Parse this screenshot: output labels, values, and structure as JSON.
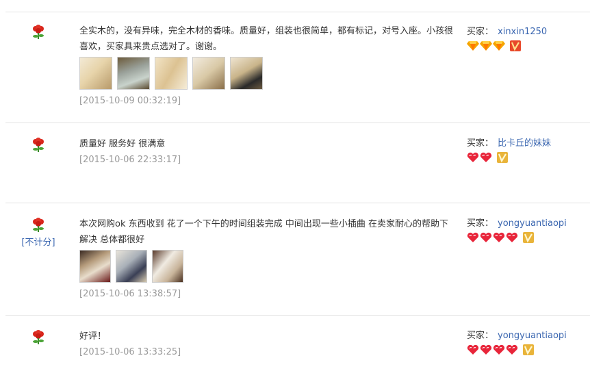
{
  "buyer_label": "买家：",
  "not_counted_label": "[不计分]",
  "reviews": [
    {
      "text": "全实木的，没有异味，完全木材的香味。质量好，组装也很简单，都有标记，对号入座。小孩很喜欢，买家具来贵点选对了。谢谢。",
      "date": "[2015-10-09 00:32:19]",
      "buyer": "xinxin1250",
      "badges": [
        "diamond",
        "diamond",
        "diamond"
      ],
      "vip": "red",
      "not_counted": false,
      "thumb_count": 5
    },
    {
      "text": "质量好 服务好 很满意",
      "date": "[2015-10-06 22:33:17]",
      "buyer": "比卡丘的妹妹",
      "badges": [
        "heart",
        "heart"
      ],
      "vip": "gold",
      "not_counted": false,
      "thumb_count": 0
    },
    {
      "text": "本次网购ok 东西收到 花了一个下午的时间组装完成 中间出现一些小插曲 在卖家耐心的帮助下解决 总体都很好",
      "date": "[2015-10-06 13:38:57]",
      "buyer": "yongyuantiaopi",
      "badges": [
        "heart",
        "heart",
        "heart",
        "heart"
      ],
      "vip": "gold",
      "not_counted": true,
      "thumb_count": 3
    },
    {
      "text": "好评！",
      "date": "[2015-10-06 13:33:25]",
      "buyer": "yongyuantiaopi",
      "badges": [
        "heart",
        "heart",
        "heart",
        "heart"
      ],
      "vip": "gold",
      "not_counted": false,
      "thumb_count": 0
    }
  ],
  "colors": {
    "link": "#3a66b0",
    "date": "#9a9a9a",
    "divider": "#e2e2e2",
    "flower": "#d9261c",
    "heart": "#e8253a",
    "diamond": "#f5a400"
  }
}
